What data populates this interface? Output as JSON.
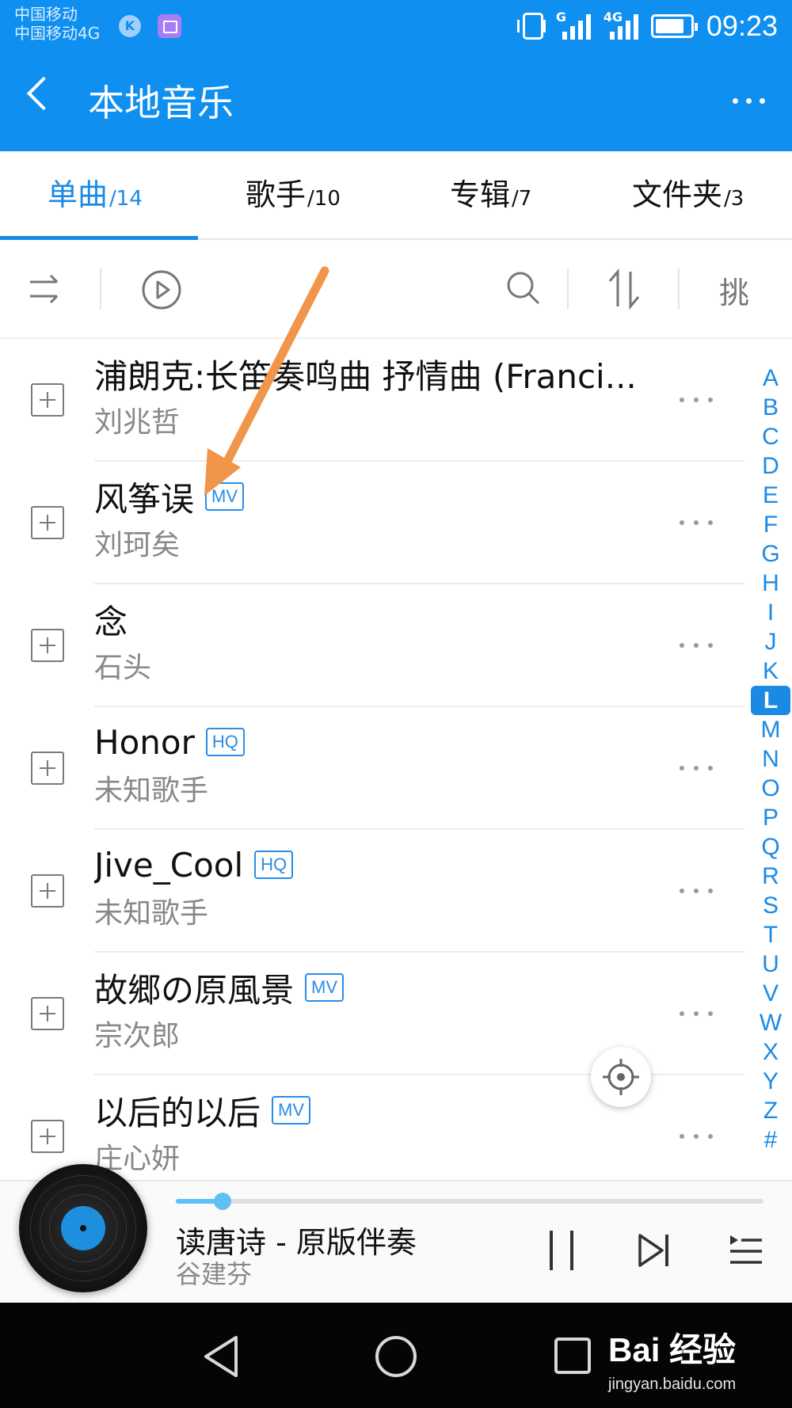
{
  "status_bar": {
    "carrier1": "中国移动",
    "carrier2": "中国移动4G",
    "sig1_tag": "G",
    "sig2_tag": "4G",
    "battery_level": 0.85,
    "time": "09:23"
  },
  "header": {
    "title": "本地音乐"
  },
  "tabs": [
    {
      "label": "单曲",
      "count": "/14",
      "active": true
    },
    {
      "label": "歌手",
      "count": "/10",
      "active": false
    },
    {
      "label": "专辑",
      "count": "/7",
      "active": false
    },
    {
      "label": "文件夹",
      "count": "/3",
      "active": false
    }
  ],
  "toolbar": {
    "pick_label": "挑"
  },
  "songs": [
    {
      "title": "浦朗克:长笛奏鸣曲 抒情曲 (Franci...",
      "artist": "刘兆哲",
      "badge": ""
    },
    {
      "title": "风筝误",
      "artist": "刘珂矣",
      "badge": "MV"
    },
    {
      "title": "念",
      "artist": "石头",
      "badge": ""
    },
    {
      "title": "Honor",
      "artist": "未知歌手",
      "badge": "HQ"
    },
    {
      "title": "Jive_Cool",
      "artist": "未知歌手",
      "badge": "HQ"
    },
    {
      "title": "故郷の原風景",
      "artist": "宗次郎",
      "badge": "MV"
    },
    {
      "title": "以后的以后",
      "artist": "庄心妍",
      "badge": "MV"
    }
  ],
  "alphabet": [
    "A",
    "B",
    "C",
    "D",
    "E",
    "F",
    "G",
    "H",
    "I",
    "J",
    "K",
    "L",
    "M",
    "N",
    "O",
    "P",
    "Q",
    "R",
    "S",
    "T",
    "U",
    "V",
    "W",
    "X",
    "Y",
    "Z",
    "#"
  ],
  "alphabet_selected": "L",
  "now_playing": {
    "title": "读唐诗 - 原版伴奏",
    "artist": "谷建芬",
    "progress": 0.08
  },
  "watermark": {
    "logo": "Bai 经验",
    "sub": "jingyan.baidu.com"
  },
  "colors": {
    "accent": "#1a8ae5",
    "header_bg": "#0f8ff0",
    "annotation_arrow": "#f0954a"
  }
}
